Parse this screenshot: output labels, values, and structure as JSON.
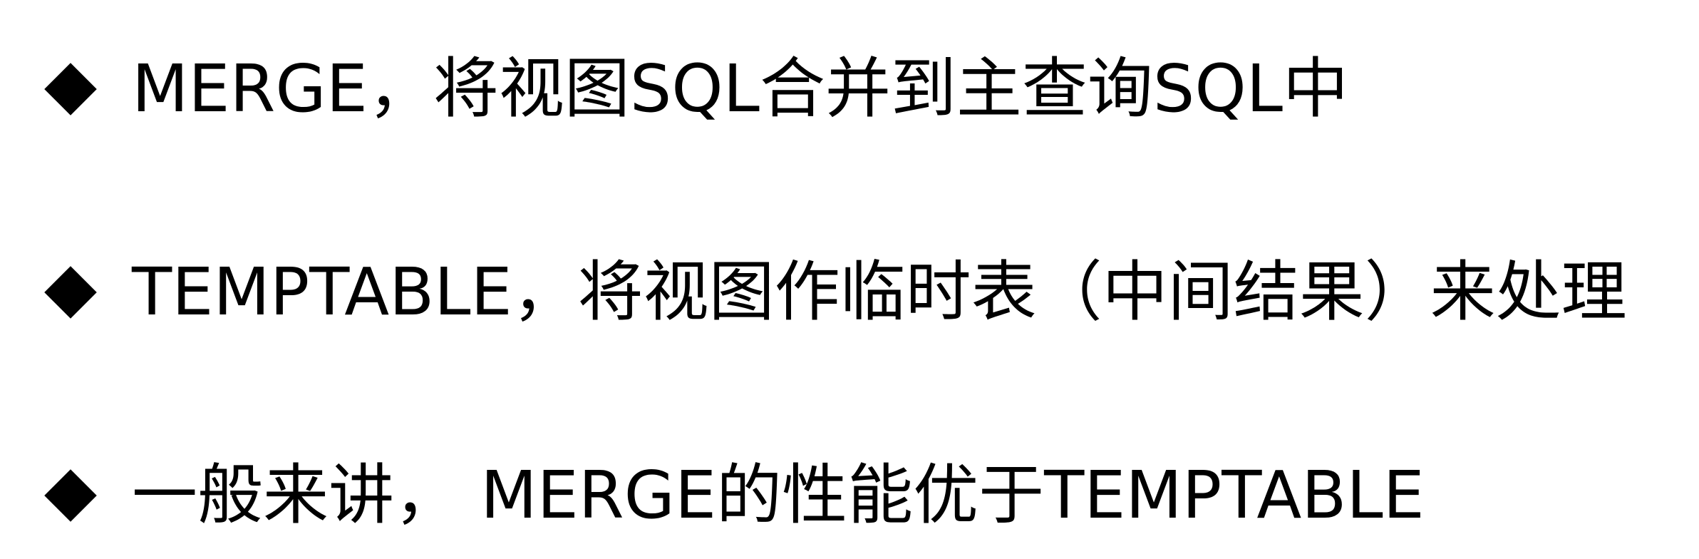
{
  "bullets": [
    {
      "icon": "diamond-bullet-icon",
      "text": "MERGE，将视图SQL合并到主查询SQL中"
    },
    {
      "icon": "diamond-bullet-icon",
      "text": "TEMPTABLE，将视图作临时表（中间结果）来处理"
    },
    {
      "icon": "diamond-bullet-icon",
      "text": "一般来讲， MERGE的性能优于TEMPTABLE"
    }
  ],
  "colors": {
    "text": "#000000",
    "background": "#ffffff"
  }
}
